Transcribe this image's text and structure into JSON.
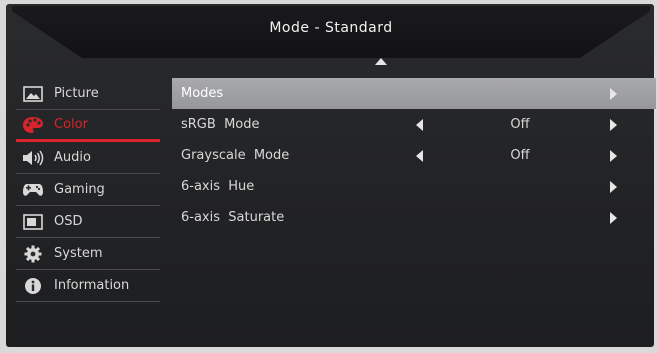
{
  "header": {
    "title": "Mode - Standard"
  },
  "sidebar": {
    "items": [
      {
        "label": "Picture",
        "icon": "picture-icon"
      },
      {
        "label": "Color",
        "icon": "palette-icon",
        "active": true
      },
      {
        "label": "Audio",
        "icon": "speaker-icon"
      },
      {
        "label": "Gaming",
        "icon": "gamepad-icon"
      },
      {
        "label": "OSD",
        "icon": "osd-icon"
      },
      {
        "label": "System",
        "icon": "gear-icon"
      },
      {
        "label": "Information",
        "icon": "info-icon"
      }
    ]
  },
  "menu": {
    "rows": [
      {
        "label": "Modes",
        "value": ""
      },
      {
        "label": "sRGB  Mode",
        "value": "Off"
      },
      {
        "label": "Grayscale  Mode",
        "value": "Off"
      },
      {
        "label": "6-axis  Hue",
        "value": ""
      },
      {
        "label": "6-axis  Saturate",
        "value": ""
      }
    ]
  },
  "colors": {
    "accent": "#d8242a",
    "selected_row": "#a0a1a3",
    "text": "#d8d8d8"
  }
}
